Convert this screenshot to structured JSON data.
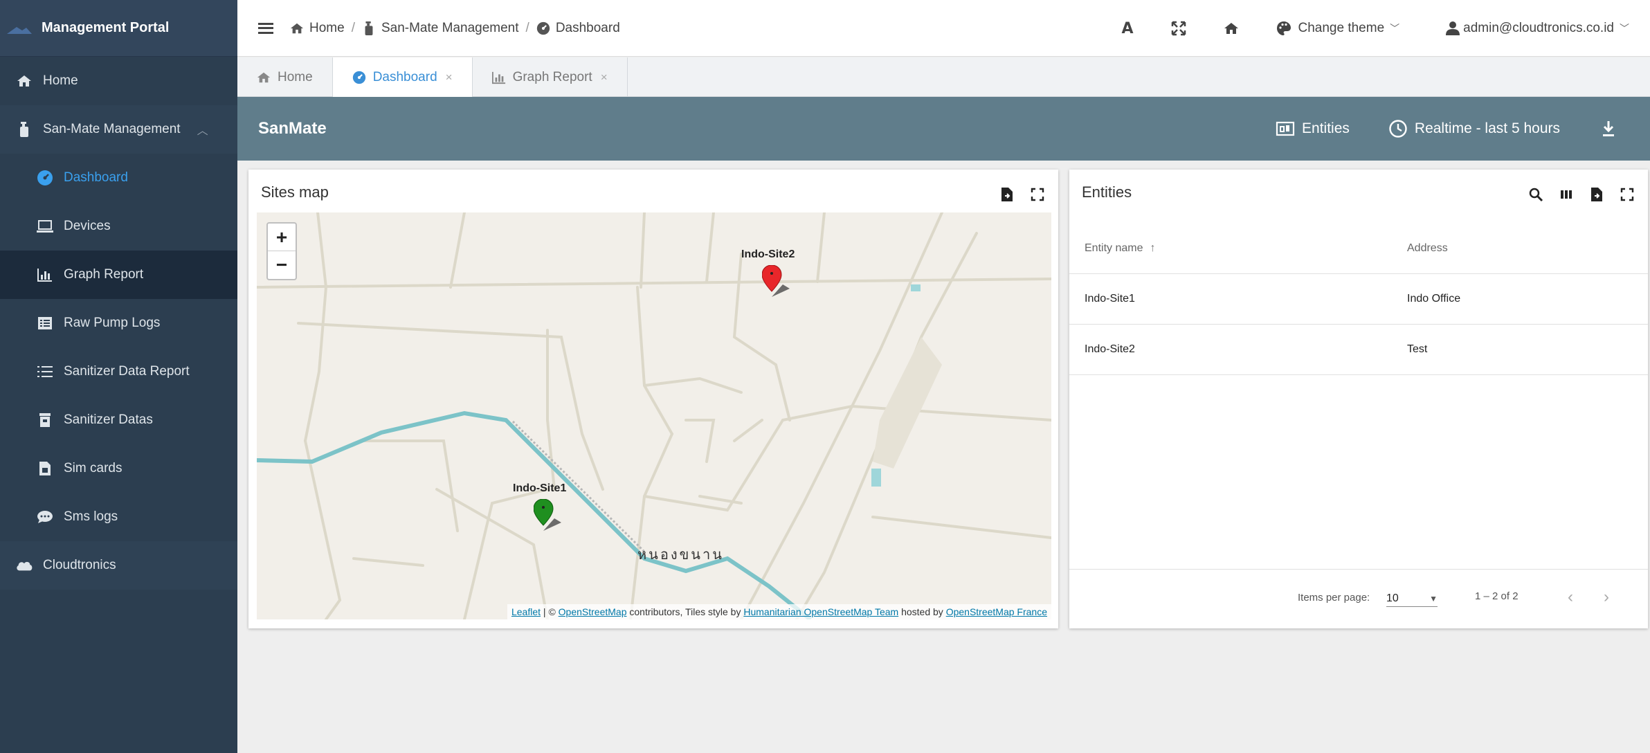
{
  "sidebar": {
    "brand_title": "Management Portal",
    "items": [
      {
        "label": "Home",
        "icon": "home-icon"
      },
      {
        "label": "San-Mate Management",
        "icon": "bottle-icon"
      },
      {
        "label": "Dashboard",
        "icon": "dashboard-icon"
      },
      {
        "label": "Devices",
        "icon": "laptop-icon"
      },
      {
        "label": "Graph Report",
        "icon": "chart-icon"
      },
      {
        "label": "Raw Pump Logs",
        "icon": "list-box-icon"
      },
      {
        "label": "Sanitizer Data Report",
        "icon": "list-icon"
      },
      {
        "label": "Sanitizer Datas",
        "icon": "bin-icon"
      },
      {
        "label": "Sim cards",
        "icon": "simcard-icon"
      },
      {
        "label": "Sms logs",
        "icon": "chat-icon"
      },
      {
        "label": "Cloudtronics",
        "icon": "cloud-icon"
      }
    ]
  },
  "topbar": {
    "breadcrumb": [
      "Home",
      "San-Mate Management",
      "Dashboard"
    ],
    "font_label": "A",
    "theme_label": "Change theme",
    "user_email": "admin@cloudtronics.co.id"
  },
  "tabs": [
    {
      "label": "Home"
    },
    {
      "label": "Dashboard",
      "close": "×"
    },
    {
      "label": "Graph Report",
      "close": "×"
    }
  ],
  "dashboard": {
    "title": "SanMate",
    "entities_label": "Entities",
    "realtime_label": "Realtime - last 5 hours"
  },
  "map_widget": {
    "title": "Sites map",
    "zoom_in": "+",
    "zoom_out": "−",
    "town_label": "หนองขนาน",
    "markers": [
      {
        "label": "Indo-Site2",
        "color": "#e8262a"
      },
      {
        "label": "Indo-Site1",
        "color": "#1f8f1f"
      }
    ],
    "attribution": {
      "leaflet": "Leaflet",
      "sep": " | © ",
      "osm": "OpenStreetMap",
      "text1": " contributors, Tiles style by ",
      "hot": "Humanitarian OpenStreetMap Team",
      "text2": " hosted by ",
      "france": "OpenStreetMap France"
    }
  },
  "entities_widget": {
    "title": "Entities",
    "columns": [
      "Entity name",
      "Address"
    ],
    "sort_indicator": "↑",
    "rows": [
      {
        "name": "Indo-Site1",
        "address": "Indo Office"
      },
      {
        "name": "Indo-Site2",
        "address": "Test"
      }
    ],
    "paginator": {
      "items_per_page_label": "Items per page:",
      "items_per_page": "10",
      "range": "1 – 2 of 2"
    }
  },
  "colors": {
    "sidebar_bg": "#2c3e50",
    "dash_header_bg": "#607d8b",
    "active_link": "#3aa0ee"
  }
}
